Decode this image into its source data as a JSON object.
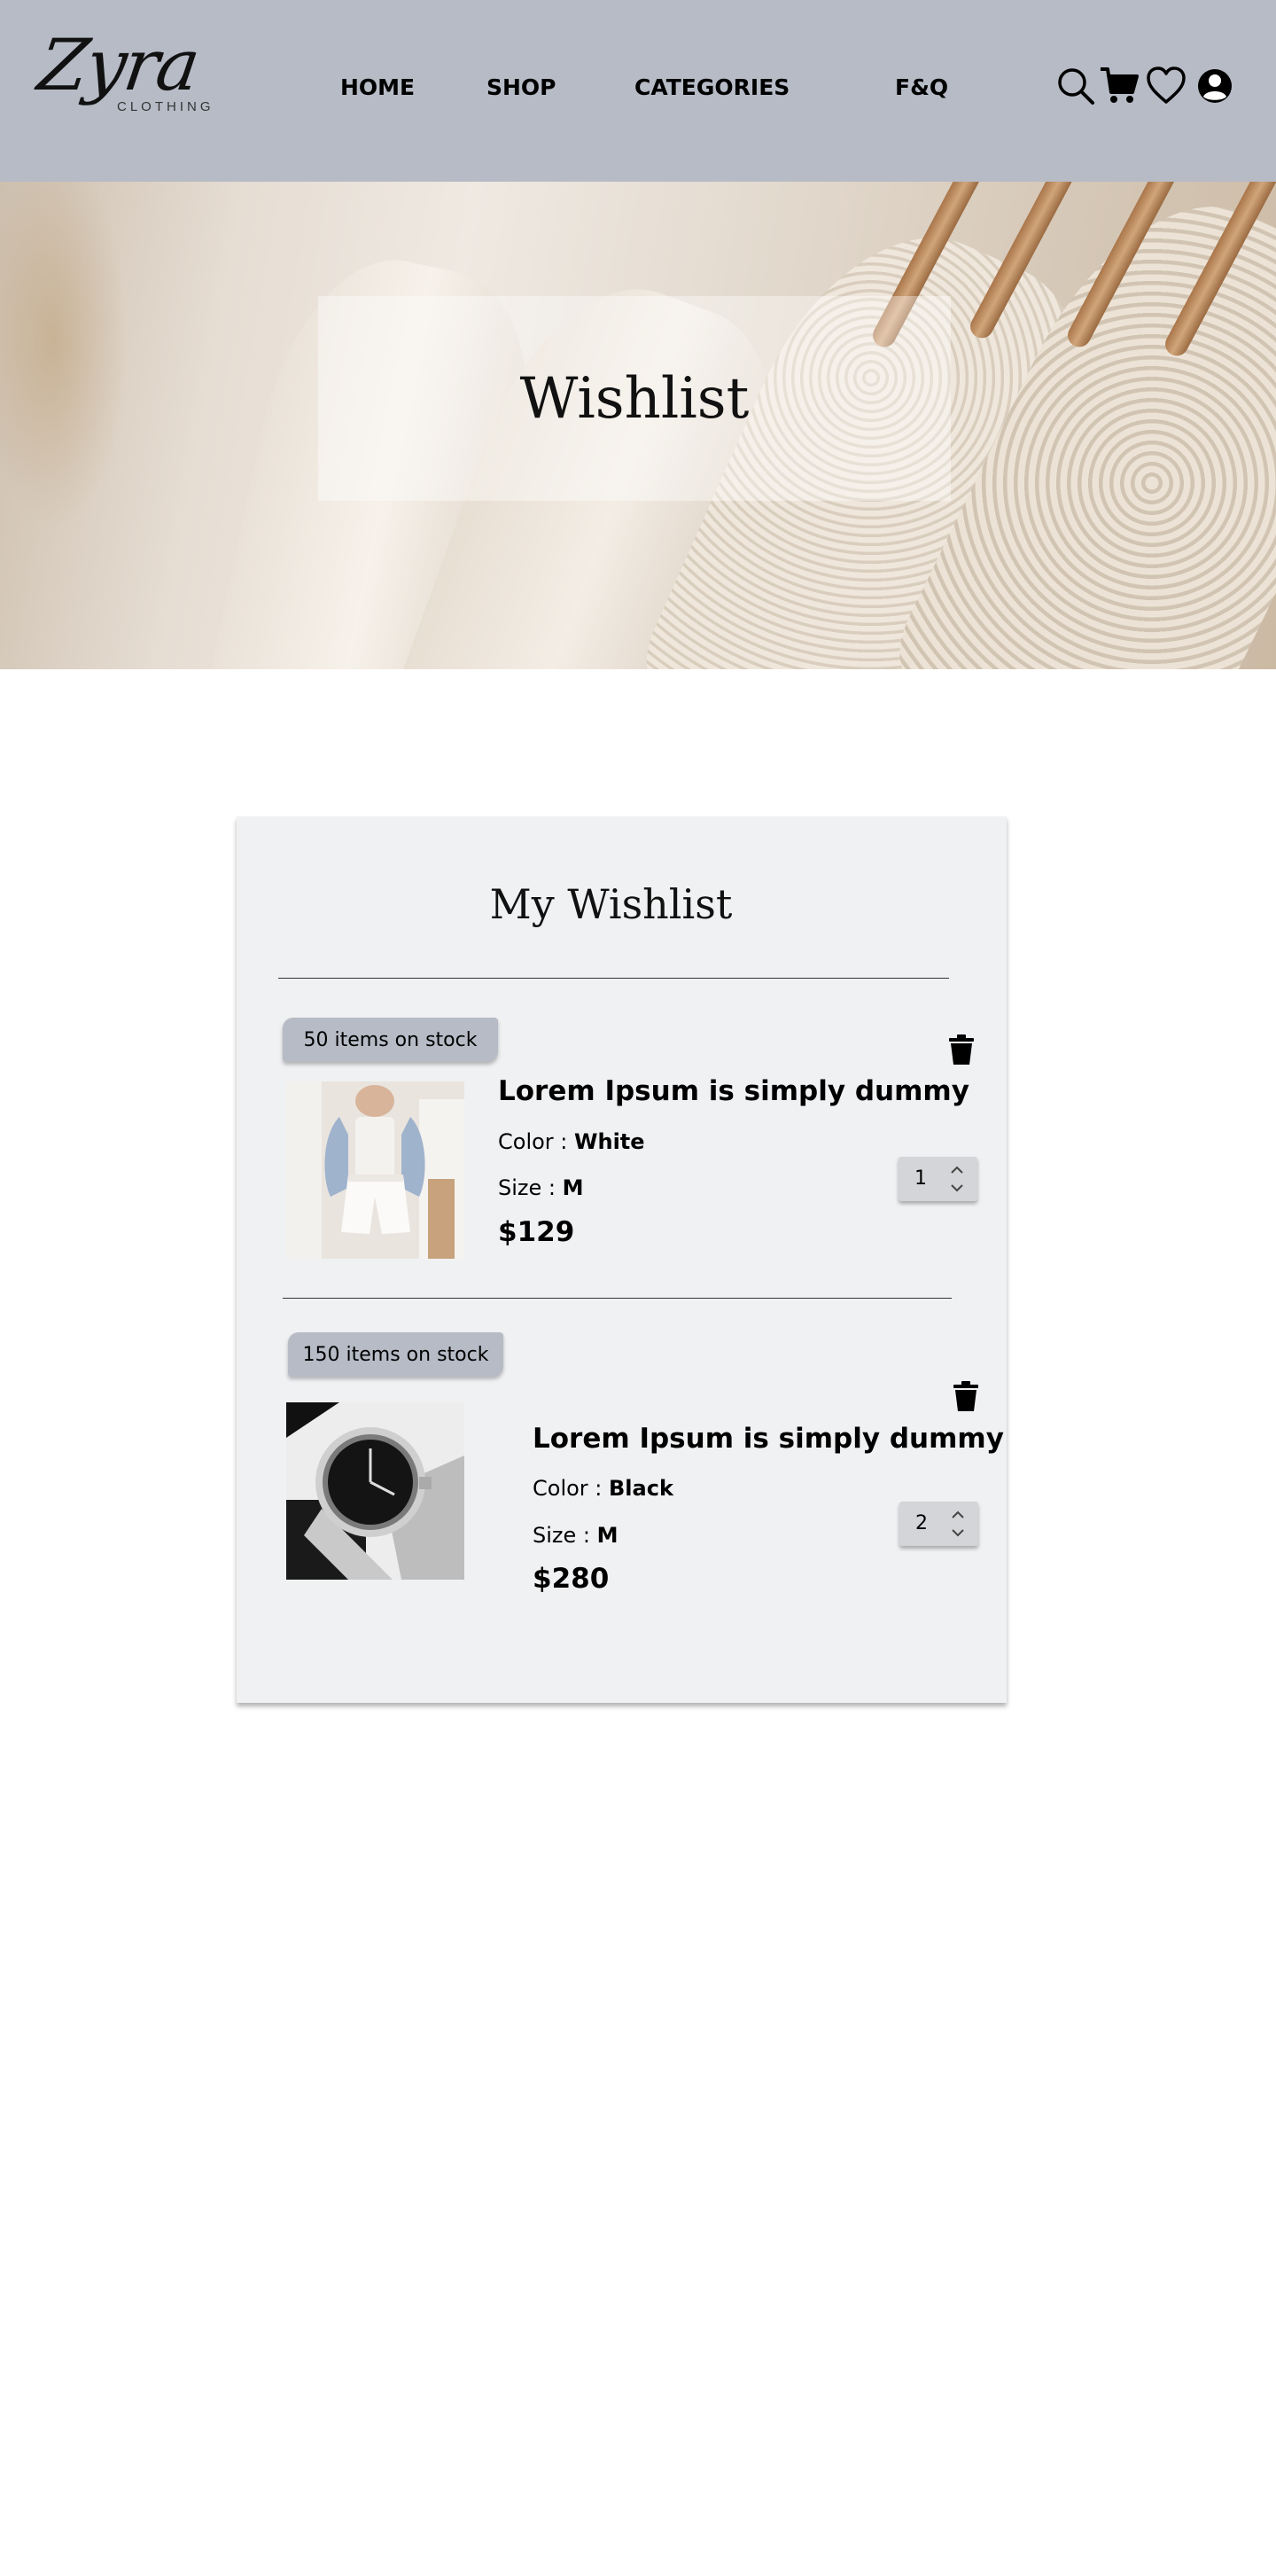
{
  "header": {
    "logo_script": "Zyra",
    "logo_sub": "CLOTHING",
    "nav": [
      {
        "label": "HOME"
      },
      {
        "label": "SHOP"
      },
      {
        "label": "CATEGORIES"
      },
      {
        "label": "F&Q"
      }
    ],
    "icons": [
      "search-icon",
      "cart-icon",
      "heart-icon",
      "user-icon"
    ]
  },
  "hero": {
    "title": "Wishlist"
  },
  "wishlist": {
    "title": "My Wishlist",
    "items": [
      {
        "stock": "50 items on stock",
        "title": "Lorem Ipsum is simply dummy",
        "color_label": "Color : ",
        "color_value": "White",
        "size_label": "Size : ",
        "size_value": "M",
        "price": "$129",
        "quantity": "1"
      },
      {
        "stock": "150 items on stock",
        "title": "Lorem Ipsum is simply dummy",
        "color_label": "Color : ",
        "color_value": "Black",
        "size_label": "Size : ",
        "size_value": "M",
        "price": "$280",
        "quantity": "2"
      }
    ]
  },
  "colors": {
    "header_bg": "#b6bbc6",
    "card_bg": "#f0f1f3",
    "badge_bg": "#b6bbc6",
    "qty_bg": "#d4d5d8"
  }
}
